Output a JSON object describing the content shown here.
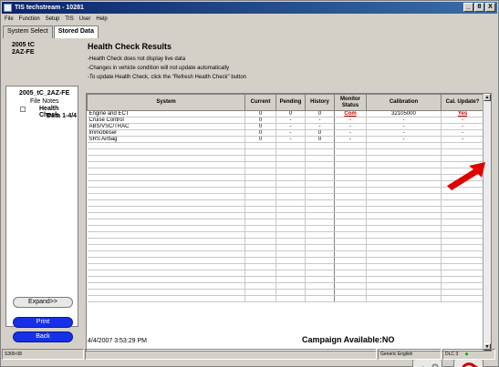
{
  "window": {
    "title": "TIS techstream - 10281",
    "buttons": [
      "_",
      "8",
      "X"
    ]
  },
  "menu": [
    "File",
    "Function",
    "Setup",
    "TIS",
    "User",
    "Help"
  ],
  "tabs": [
    "System Select",
    "Stored Data"
  ],
  "left": {
    "vehicle_line1": "2005 tC",
    "vehicle_line2": "2AZ-FE",
    "tree": [
      "2005_tC_2AZ-FE",
      "File Notes",
      "Health Check",
      "Data 1-4/4"
    ],
    "expand": "Expand>>",
    "print": "Print",
    "back": "Back"
  },
  "main": {
    "title": "Health Check Results",
    "notes": [
      "-Health Check does not display live data",
      "-Changes in vehicle condition will not update automatically",
      "-To update Health Check, click the \"Refresh Health Check\" button"
    ],
    "columns": [
      "System",
      "Current",
      "Pending",
      "History",
      "Monitor Status",
      "Calibration",
      "Cal. Update?"
    ],
    "rows": [
      [
        "Engine and ECT",
        "0",
        "0",
        "0",
        "Com",
        "32105000",
        "Yes"
      ],
      [
        "Cruise Control",
        "0",
        "-",
        "-",
        "-",
        "-",
        "-"
      ],
      [
        "ABS/VSC/TRAC",
        "0",
        "-",
        "-",
        "-",
        "-",
        "-"
      ],
      [
        "Immobiliser",
        "0",
        "-",
        "0",
        "-",
        "-",
        "-"
      ],
      [
        "SRS Airbag",
        "0",
        "-",
        "0",
        "-",
        "-",
        "-"
      ]
    ],
    "timestamp": "4/4/2007 3:53:29 PM",
    "campaign": "Campaign Available:NO"
  },
  "status": {
    "left": "S309-08",
    "language": "Generic English",
    "dlc": "DLC 3"
  },
  "colors": {
    "link": "#cc0000",
    "button_blue": "#1530e8",
    "arrow": "#e00000"
  }
}
